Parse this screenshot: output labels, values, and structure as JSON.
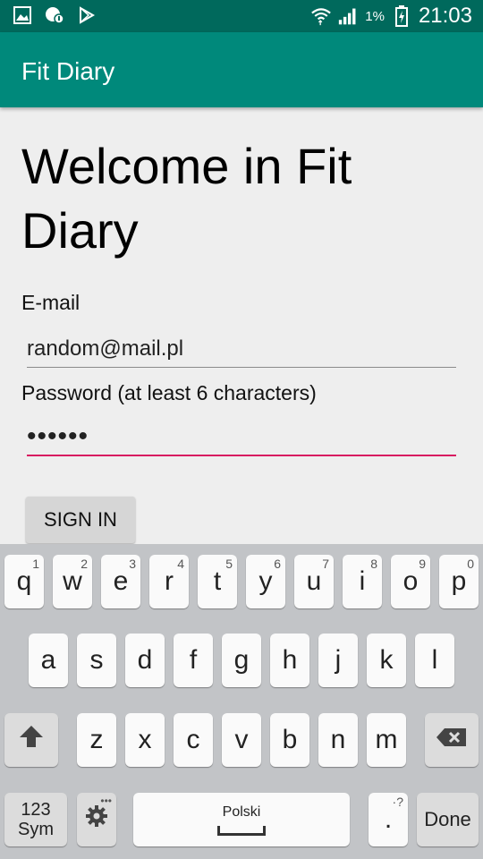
{
  "status_bar": {
    "icons": [
      "gallery-icon",
      "notification-icon",
      "play-store-icon",
      "wifi-icon",
      "signal-icon",
      "battery-icon"
    ],
    "battery": "1%",
    "time": "21:03"
  },
  "app_bar": {
    "title": "Fit Diary"
  },
  "form": {
    "welcome": "Welcome in Fit Diary",
    "email_label": "E-mail",
    "email_value": "random@mail.pl",
    "password_label": "Password (at least 6 characters)",
    "password_value": "••••••",
    "sign_in_label": "SIGN IN"
  },
  "keyboard": {
    "row1": [
      {
        "key": "q",
        "num": "1"
      },
      {
        "key": "w",
        "num": "2"
      },
      {
        "key": "e",
        "num": "3"
      },
      {
        "key": "r",
        "num": "4"
      },
      {
        "key": "t",
        "num": "5"
      },
      {
        "key": "y",
        "num": "6"
      },
      {
        "key": "u",
        "num": "7"
      },
      {
        "key": "i",
        "num": "8"
      },
      {
        "key": "o",
        "num": "9"
      },
      {
        "key": "p",
        "num": "0"
      }
    ],
    "row2": [
      "a",
      "s",
      "d",
      "f",
      "g",
      "h",
      "j",
      "k",
      "l"
    ],
    "row3": [
      "z",
      "x",
      "c",
      "v",
      "b",
      "n",
      "m"
    ],
    "symbols_key": [
      "123",
      "Sym"
    ],
    "space_label": "Polski",
    "period_key": ".",
    "period_hint": "·?",
    "done_label": "Done",
    "shift_icon": "shift-icon",
    "backspace_icon": "backspace-icon",
    "settings_icon": "gear-icon"
  },
  "colors": {
    "status_bar": "#00695c",
    "app_bar": "#00897b",
    "accent": "#d81b60",
    "background": "#eeeeee",
    "keyboard": "#c2c4c7"
  }
}
